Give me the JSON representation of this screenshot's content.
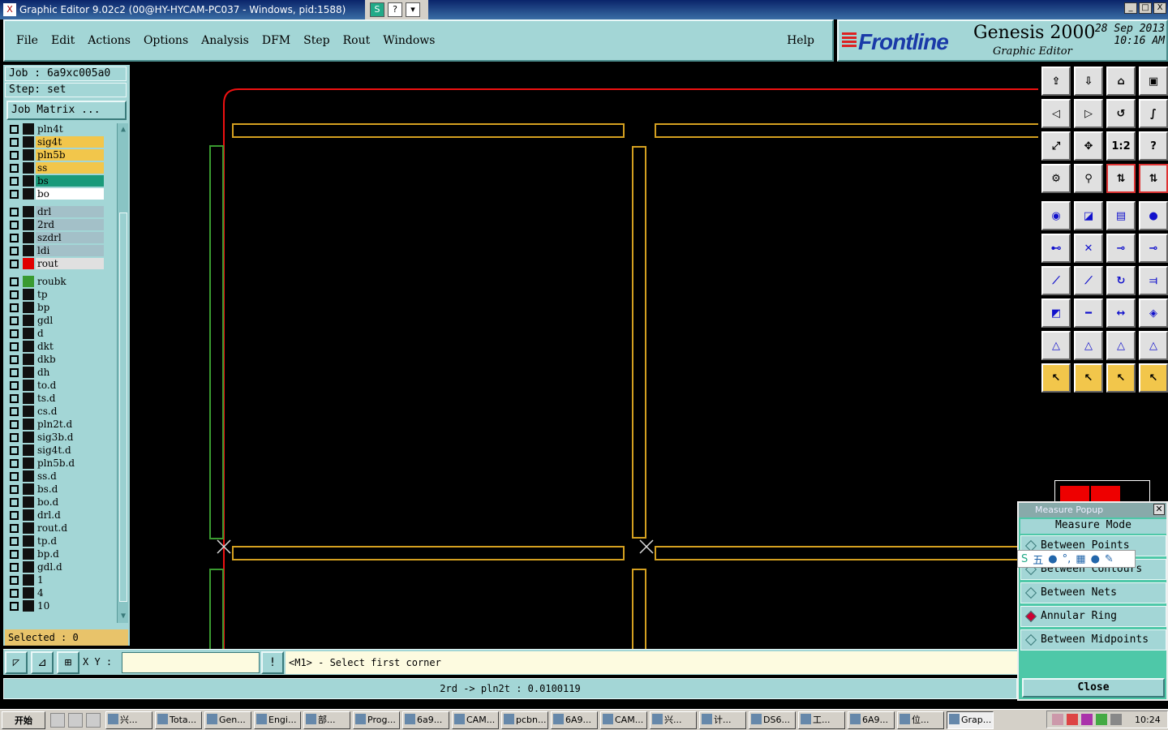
{
  "window": {
    "title": "Graphic Editor 9.02c2 (00@HY-HYCAM-PC037 - Windows, pid:1588)",
    "ext_icons": [
      "S",
      "?",
      "▾"
    ],
    "controls": [
      "_",
      "□",
      "X"
    ]
  },
  "menu": {
    "items": [
      "File",
      "Edit",
      "Actions",
      "Options",
      "Analysis",
      "DFM",
      "Step",
      "Rout",
      "Windows"
    ],
    "help": "Help"
  },
  "brand": {
    "logo": "Frontline",
    "product": "Genesis 2000",
    "subtitle": "Graphic Editor",
    "date": "28 Sep 2013",
    "time": "10:16 AM"
  },
  "job": {
    "job_label": "Job : 6a9xc005a0",
    "step_label": "Step: set",
    "matrix_button": "Job Matrix ...",
    "selected": "Selected : 0"
  },
  "layers": [
    {
      "name": "pln4t",
      "color": "#a3d6d6",
      "swatch": "#111111"
    },
    {
      "name": "sig4t",
      "color": "#f2c64b",
      "swatch": "#111111"
    },
    {
      "name": "pln5b",
      "color": "#f2c64b",
      "swatch": "#111111"
    },
    {
      "name": "ss",
      "color": "#f2c64b",
      "swatch": "#111111"
    },
    {
      "name": "bs",
      "color": "#1a9a7a",
      "swatch": "#111111"
    },
    {
      "name": "bo",
      "color": "#ffffff",
      "swatch": "#111111"
    },
    {
      "name": "drl",
      "color": "#a3c0c8",
      "swatch": "#111111"
    },
    {
      "name": "2rd",
      "color": "#a3c0c8",
      "swatch": "#111111"
    },
    {
      "name": "szdrl",
      "color": "#a3c0c8",
      "swatch": "#111111"
    },
    {
      "name": "ldi",
      "color": "#a3c0c8",
      "swatch": "#111111"
    },
    {
      "name": "rout",
      "color": "#e0e0e0",
      "swatch": "#e00000"
    },
    {
      "name": "roubk",
      "color": "#a3d6d6",
      "swatch": "#3a9a30"
    },
    {
      "name": "tp",
      "color": "#a3d6d6",
      "swatch": "#111111"
    },
    {
      "name": "bp",
      "color": "#a3d6d6",
      "swatch": "#111111"
    },
    {
      "name": "gdl",
      "color": "#a3d6d6",
      "swatch": "#111111"
    },
    {
      "name": "d",
      "color": "#a3d6d6",
      "swatch": "#111111"
    },
    {
      "name": "dkt",
      "color": "#a3d6d6",
      "swatch": "#111111"
    },
    {
      "name": "dkb",
      "color": "#a3d6d6",
      "swatch": "#111111"
    },
    {
      "name": "dh",
      "color": "#a3d6d6",
      "swatch": "#111111"
    },
    {
      "name": "to.d",
      "color": "#a3d6d6",
      "swatch": "#111111"
    },
    {
      "name": "ts.d",
      "color": "#a3d6d6",
      "swatch": "#111111"
    },
    {
      "name": "cs.d",
      "color": "#a3d6d6",
      "swatch": "#111111"
    },
    {
      "name": "pln2t.d",
      "color": "#a3d6d6",
      "swatch": "#111111"
    },
    {
      "name": "sig3b.d",
      "color": "#a3d6d6",
      "swatch": "#111111"
    },
    {
      "name": "sig4t.d",
      "color": "#a3d6d6",
      "swatch": "#111111"
    },
    {
      "name": "pln5b.d",
      "color": "#a3d6d6",
      "swatch": "#111111"
    },
    {
      "name": "ss.d",
      "color": "#a3d6d6",
      "swatch": "#111111"
    },
    {
      "name": "bs.d",
      "color": "#a3d6d6",
      "swatch": "#111111"
    },
    {
      "name": "bo.d",
      "color": "#a3d6d6",
      "swatch": "#111111"
    },
    {
      "name": "drl.d",
      "color": "#a3d6d6",
      "swatch": "#111111"
    },
    {
      "name": "rout.d",
      "color": "#a3d6d6",
      "swatch": "#111111"
    },
    {
      "name": "tp.d",
      "color": "#a3d6d6",
      "swatch": "#111111"
    },
    {
      "name": "bp.d",
      "color": "#a3d6d6",
      "swatch": "#111111"
    },
    {
      "name": "gdl.d",
      "color": "#a3d6d6",
      "swatch": "#111111"
    },
    {
      "name": "1",
      "color": "#a3d6d6",
      "swatch": "#111111"
    },
    {
      "name": "4",
      "color": "#a3d6d6",
      "swatch": "#111111"
    },
    {
      "name": "10",
      "color": "#a3d6d6",
      "swatch": "#111111"
    }
  ],
  "tools": {
    "labels": [
      "",
      "",
      "",
      "",
      "",
      "",
      "",
      "",
      "",
      "",
      "1:2",
      "?"
    ],
    "icons": [
      "open-job-icon",
      "save-icon",
      "home-icon",
      "window-icon",
      "back-icon",
      "forward-icon",
      "undo-icon",
      "s-curve-icon",
      "zoom-fit-icon",
      "zoom-center-icon",
      "scale-icon",
      "help-icon",
      "filter-icon",
      "snap-icon",
      "layer-red-icon",
      "layer-red-icon",
      "pad-icon",
      "edit-shape-icon",
      "ruler-icon",
      "circle-icon",
      "net-icon",
      "cross-icon",
      "point-icon",
      "point-icon",
      "line-red-icon",
      "line-icon",
      "arc-icon",
      "align-icon",
      "square-point-icon",
      "line-h-icon",
      "dimension-icon",
      "shapes-icon",
      "triangle-icon",
      "triangle-icon",
      "triangle-icon",
      "triangle-icon",
      "cursor-icon",
      "cursor-icon",
      "cursor-icon",
      "cursor-icon"
    ]
  },
  "measure": {
    "title": "Measure Popup",
    "mode": "Measure Mode",
    "options": [
      "Between Points",
      "Between Contours",
      "Between Nets",
      "Annular Ring",
      "Between Midpoints"
    ],
    "selected_index": 3,
    "close": "Close"
  },
  "ime": {
    "labels": [
      "五",
      "●",
      "°,",
      "▦",
      "●",
      "✎"
    ]
  },
  "command": {
    "xy_label": "X Y :",
    "xy_value": "",
    "exclaim": "!",
    "prompt": "<M1> - Select first corner",
    "status": "2rd -> pln2t : 0.0100119"
  },
  "taskbar": {
    "start": "开始",
    "tasks": [
      "兴...",
      "Tota...",
      "Gen...",
      "Engi...",
      "部...",
      "Prog...",
      "6a9...",
      "CAM...",
      "pcbn...",
      "6A9...",
      "CAM...",
      "兴...",
      "计...",
      "DS6...",
      "工...",
      "6A9...",
      "位...",
      "Grap..."
    ],
    "active_index": 17,
    "clock": "10:24"
  }
}
